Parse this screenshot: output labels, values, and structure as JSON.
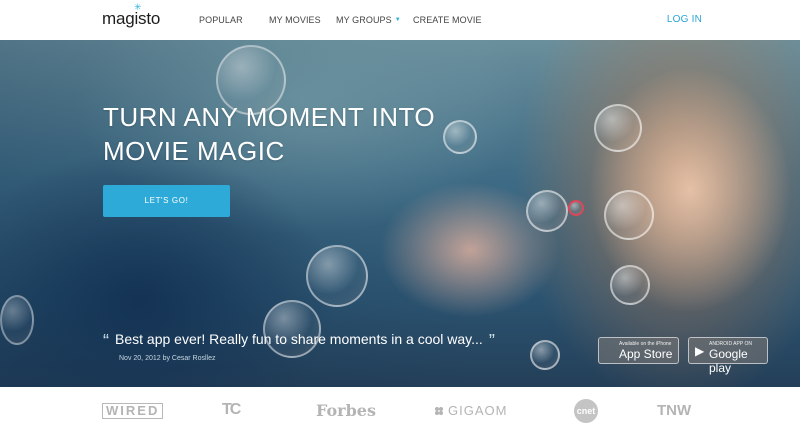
{
  "header": {
    "logo": "magisto",
    "nav": [
      {
        "label": "POPULAR"
      },
      {
        "label": "MY MOVIES"
      },
      {
        "label": "MY GROUPS"
      },
      {
        "label": "CREATE MOVIE"
      }
    ],
    "login": "LOG IN"
  },
  "hero": {
    "headline_line1": "TURN ANY MOMENT INTO",
    "headline_line2": "MOVIE MAGIC",
    "cta": "LET'S GO!",
    "quote": "Best app ever! Really fun to share moments in a cool way...",
    "quote_meta": "Nov 20, 2012  by Cesar Rosllez",
    "app_store": {
      "small": "Available on the iPhone",
      "big": "App Store"
    },
    "google_play": {
      "small": "ANDROID APP ON",
      "big": "Google play"
    }
  },
  "press": {
    "logos": [
      "WIRED",
      "TC",
      "Forbes",
      "GIGAOM",
      "cnet",
      "TNW"
    ]
  },
  "colors": {
    "accent": "#2eaad8",
    "login": "#2aa4d3",
    "press_gray": "#b4b4b4"
  },
  "icons": [
    "magisto-star-icon",
    "apple-icon",
    "google-play-icon",
    "gigaom-icon",
    "quote-open-icon",
    "quote-close-icon",
    "dropdown-caret-icon"
  ]
}
